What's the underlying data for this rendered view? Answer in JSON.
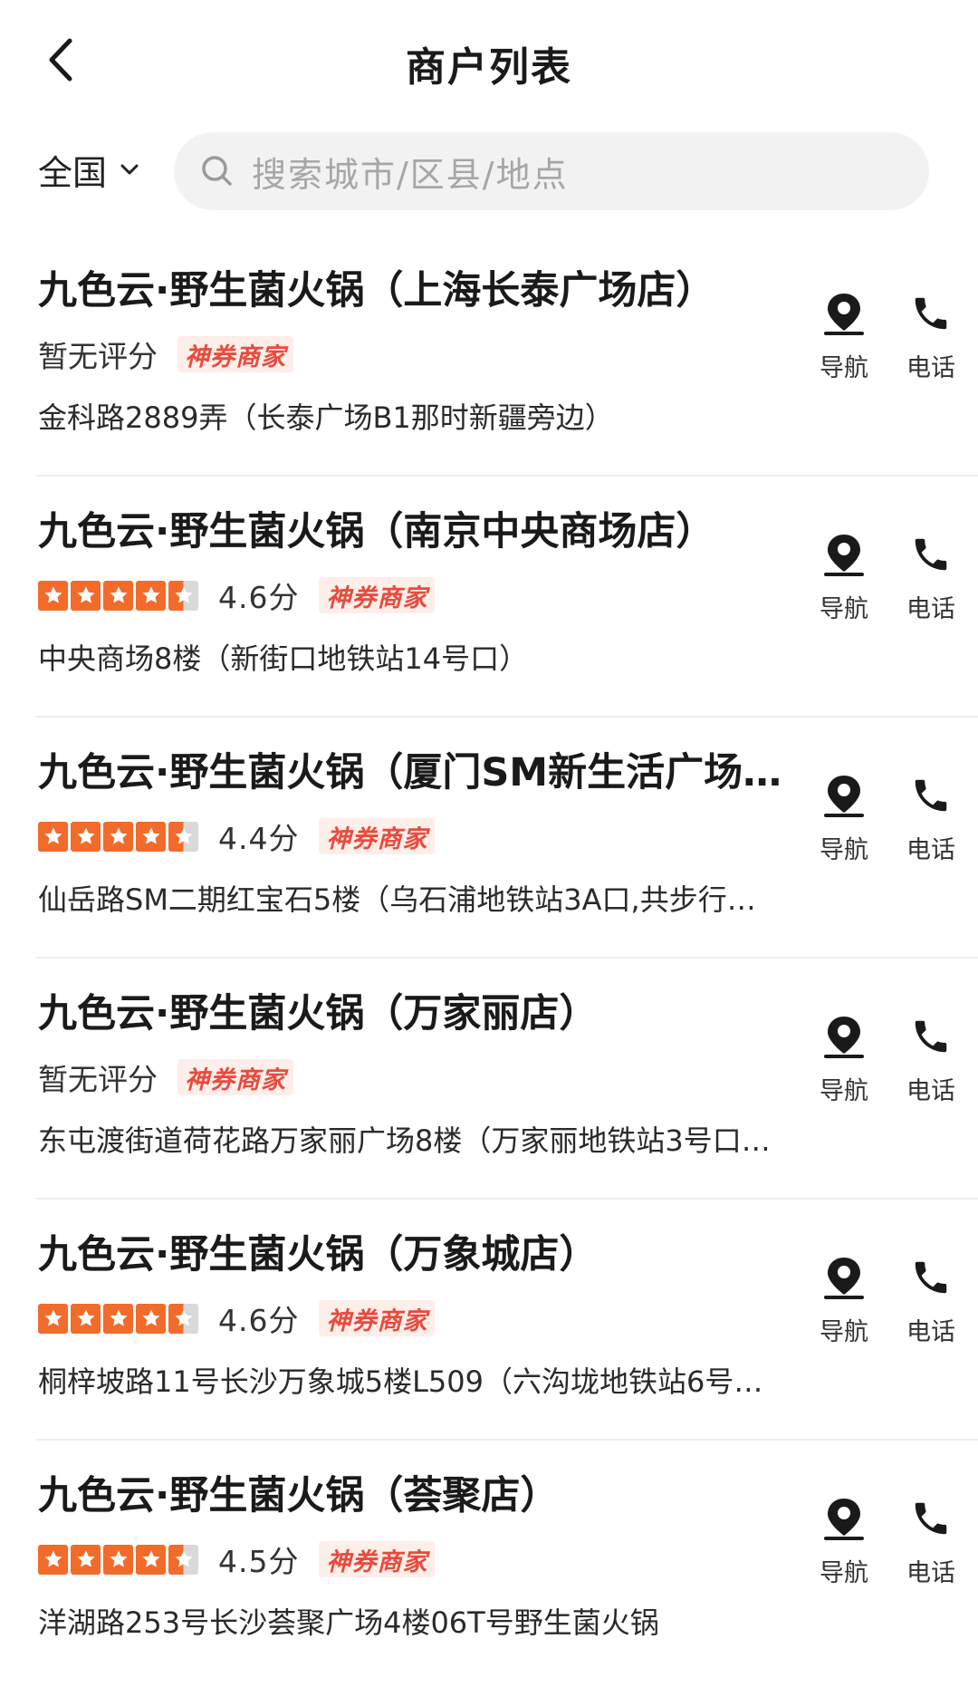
{
  "header": {
    "title": "商户列表"
  },
  "filter": {
    "region": "全国",
    "search_placeholder": "搜索城市/区县/地点"
  },
  "actions": {
    "nav_label": "导航",
    "phone_label": "电话"
  },
  "badge_label": "神券商家",
  "colors": {
    "star": "#f26b2b",
    "badge_text": "#ea4a3c",
    "badge_bg": "#fdeee9"
  },
  "merchants": [
    {
      "name": "九色云·野生菌火锅（上海长泰广场店）",
      "rating_text": "暂无评分",
      "score": "",
      "stars": 0,
      "address": "金科路2889弄（长泰广场B1那时新疆旁边）"
    },
    {
      "name": "九色云·野生菌火锅（南京中央商场店）",
      "rating_text": "",
      "score": "4.6分",
      "stars": 4.6,
      "address": "中央商场8楼（新街口地铁站14号口）"
    },
    {
      "name": "九色云·野生菌火锅（厦门SM新生活广场…",
      "rating_text": "",
      "score": "4.4分",
      "stars": 4.4,
      "address": "仙岳路SM二期红宝石5楼（乌石浦地铁站3A口,共步行…"
    },
    {
      "name": "九色云·野生菌火锅（万家丽店）",
      "rating_text": "暂无评分",
      "score": "",
      "stars": 0,
      "address": "东屯渡街道荷花路万家丽广场8楼（万家丽地铁站3号口…"
    },
    {
      "name": "九色云·野生菌火锅（万象城店）",
      "rating_text": "",
      "score": "4.6分",
      "stars": 4.6,
      "address": "桐梓坡路11号长沙万象城5楼L509（六沟垅地铁站6号…"
    },
    {
      "name": "九色云·野生菌火锅（荟聚店）",
      "rating_text": "",
      "score": "4.5分",
      "stars": 4.5,
      "address": "洋湖路253号长沙荟聚广场4楼06T号野生菌火锅"
    }
  ]
}
